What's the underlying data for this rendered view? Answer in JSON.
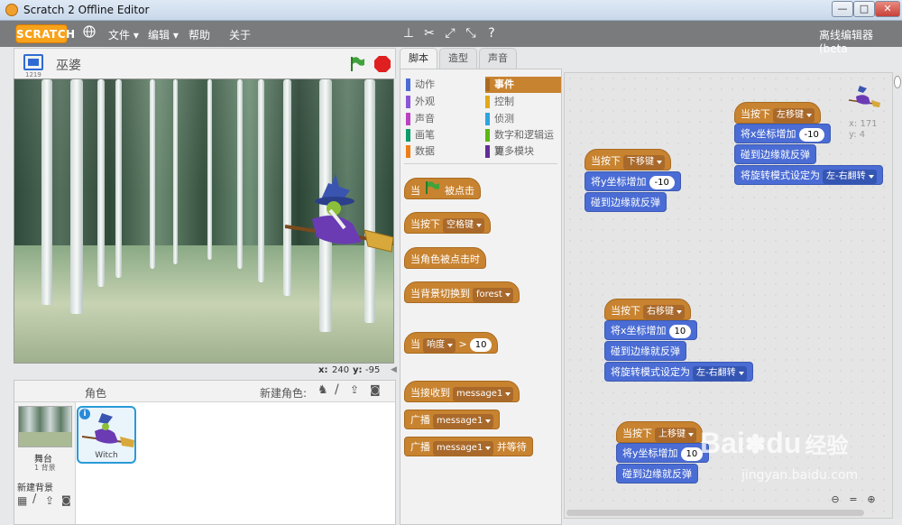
{
  "window": {
    "title": "Scratch 2 Offline Editor",
    "min": "—",
    "max": "□",
    "close": "✕"
  },
  "menubar": {
    "logo": "SCRATCH",
    "file": "文件 ▾",
    "edit": "编辑 ▾",
    "help": "帮助",
    "about": "关于",
    "right_label": "离线编辑器 (beta"
  },
  "stage": {
    "sprite_name": "巫婆",
    "version": "1219",
    "coord_x_label": "x:",
    "coord_x": "240",
    "coord_y_label": "y:",
    "coord_y": "-95"
  },
  "sprites": {
    "header_label": "角色",
    "new_sprite_label": "新建角色:",
    "stage_label": "舞台",
    "backdrop_count": "1 背景",
    "new_backdrop_label": "新建背景",
    "items": [
      {
        "name": "Witch"
      }
    ]
  },
  "tabs": [
    "脚本",
    "造型",
    "声音"
  ],
  "categories": [
    {
      "label": "动作",
      "color": "#4a6cd4"
    },
    {
      "label": "外观",
      "color": "#8a55d7"
    },
    {
      "label": "声音",
      "color": "#bb42c3"
    },
    {
      "label": "画笔",
      "color": "#0e9a6c"
    },
    {
      "label": "数据",
      "color": "#ee7d16"
    },
    {
      "label": "事件",
      "color": "#c88330",
      "selected": true
    },
    {
      "label": "控制",
      "color": "#e1a91a"
    },
    {
      "label": "侦测",
      "color": "#2ca5e2"
    },
    {
      "label": "数字和逻辑运算",
      "color": "#5cb712"
    },
    {
      "label": "更多模块",
      "color": "#632d99"
    }
  ],
  "palette_blocks": {
    "flag_when": "当",
    "flag_clicked": "被点击",
    "key_pressed": "当按下",
    "key_space": "空格键",
    "sprite_clicked": "当角色被点击时",
    "backdrop_switch": "当背景切换到",
    "backdrop_name": "forest",
    "when": "当",
    "loudness": "响度",
    "gt": ">",
    "loudness_value": "10",
    "receive": "当接收到",
    "message": "message1",
    "broadcast": "广播",
    "broadcast_wait": "并等待"
  },
  "scripts": {
    "hat_label": "当按下",
    "change_x": "将x坐标增加",
    "change_y": "将y坐标增加",
    "bounce": "碰到边缘就反弹",
    "set_rotation": "将旋转模式设定为",
    "rotation_lr": "左-右翻转",
    "s1": {
      "key": "下移键",
      "value": "-10"
    },
    "s2": {
      "key": "左移键",
      "value": "-10"
    },
    "s3": {
      "key": "右移键",
      "value": "10"
    },
    "s4": {
      "key": "上移键",
      "value": "10"
    },
    "sprite_x": "x: 171",
    "sprite_y": "y: 4"
  },
  "watermark": {
    "brand": "Bai",
    "brand2": "du",
    "text": "经验",
    "url": "jingyan.baidu.com"
  }
}
